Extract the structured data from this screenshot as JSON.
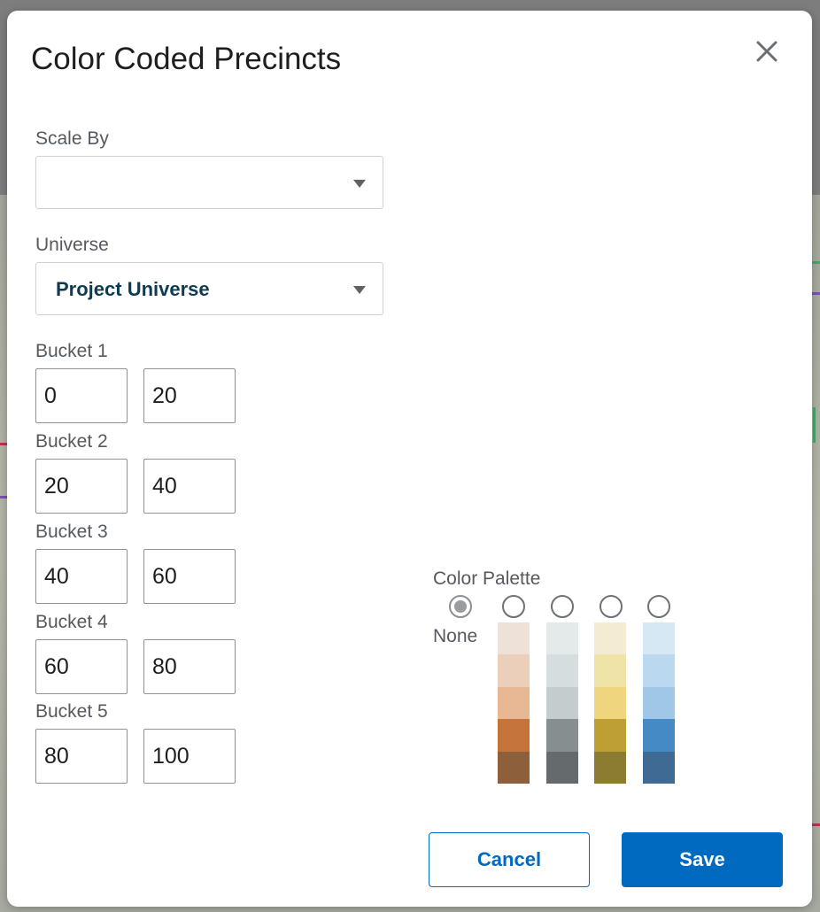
{
  "dialog": {
    "title": "Color Coded Precincts",
    "close_icon": "close-icon"
  },
  "scale_by": {
    "label": "Scale By",
    "value": ""
  },
  "universe": {
    "label": "Universe",
    "value": "Project Universe"
  },
  "buckets": [
    {
      "label": "Bucket 1",
      "min": "0",
      "max": "20"
    },
    {
      "label": "Bucket 2",
      "min": "20",
      "max": "40"
    },
    {
      "label": "Bucket 3",
      "min": "40",
      "max": "60"
    },
    {
      "label": "Bucket 4",
      "min": "60",
      "max": "80"
    },
    {
      "label": "Bucket 5",
      "min": "80",
      "max": "100"
    }
  ],
  "palette": {
    "label": "Color Palette",
    "none_label": "None",
    "selected": "none",
    "options": [
      {
        "name": "brown",
        "colors": [
          "#ede1d8",
          "#ebcfbb",
          "#e7b893",
          "#c5743c",
          "#8e5f3b"
        ]
      },
      {
        "name": "gray",
        "colors": [
          "#e4e9ea",
          "#d6dddf",
          "#c5cccd",
          "#868e8f",
          "#656b6c"
        ]
      },
      {
        "name": "gold",
        "colors": [
          "#f3ecd2",
          "#f0e3a8",
          "#efd57d",
          "#bd9f34",
          "#8b7c32"
        ]
      },
      {
        "name": "blue",
        "colors": [
          "#d7e8f5",
          "#bad8ef",
          "#a0c6e8",
          "#468ac3",
          "#3e6a93"
        ]
      }
    ]
  },
  "actions": {
    "cancel_label": "Cancel",
    "save_label": "Save"
  },
  "colors": {
    "primary": "#0069c0",
    "value_text": "#0d3b52"
  }
}
